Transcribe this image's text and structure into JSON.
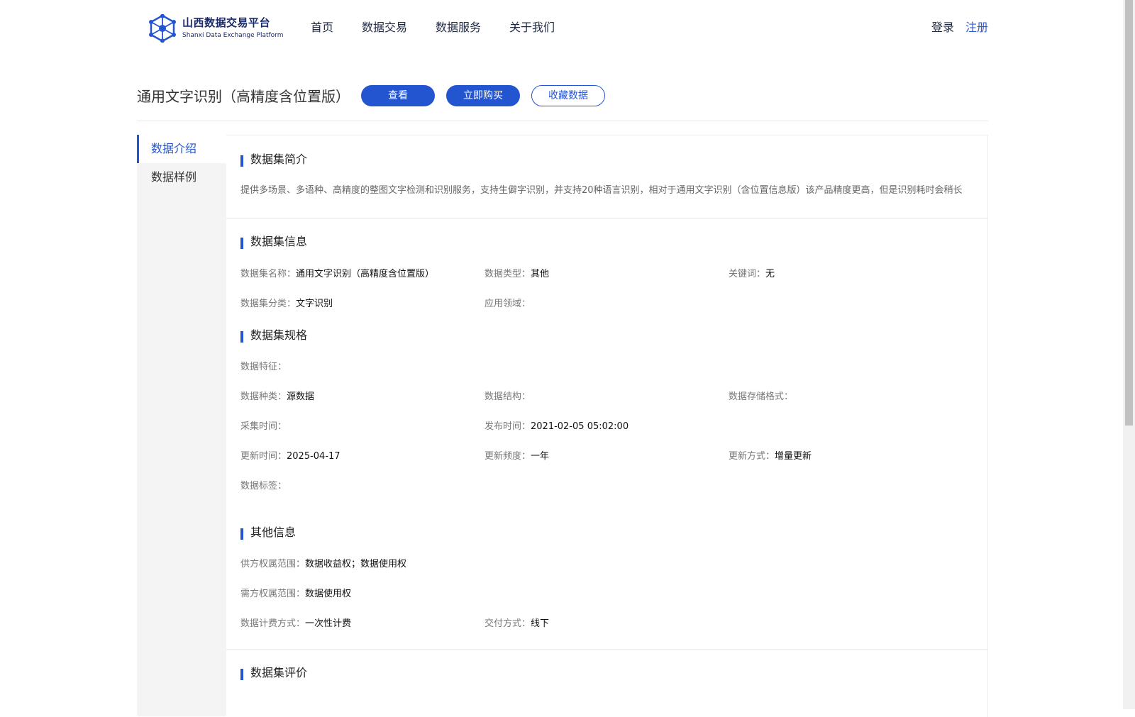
{
  "header": {
    "logo_cn": "山西数据交易平台",
    "logo_en": "Shanxi Data Exchange Platform",
    "logo_icon": "hexagon-network-icon",
    "nav": [
      "首页",
      "数据交易",
      "数据服务",
      "关于我们"
    ],
    "login": "登录",
    "register": "注册"
  },
  "title_bar": {
    "title": "通用文字识别（高精度含位置版）",
    "view_button": "查看",
    "buy_button": "立即购买",
    "favorite_button": "收藏数据"
  },
  "sidebar": {
    "items": [
      "数据介绍",
      "数据样例"
    ],
    "active": "数据介绍"
  },
  "sections": {
    "intro": {
      "title": "数据集简介",
      "text": "提供多场景、多语种、高精度的整图文字检测和识别服务，支持生僻字识别，并支持20种语言识别，相对于通用文字识别（含位置信息版）该产品精度更高，但是识别耗时会稍长"
    },
    "info": {
      "title": "数据集信息",
      "name_label": "数据集名称：",
      "name_value": "通用文字识别（高精度含位置版）",
      "type_label": "数据类型：",
      "type_value": "其他",
      "keyword_label": "关键词：",
      "keyword_value": "无",
      "category_label": "数据集分类：",
      "category_value": "文字识别",
      "domain_label": "应用领域：",
      "domain_value": ""
    },
    "spec": {
      "title": "数据集规格",
      "feature_label": "数据特征：",
      "feature_value": "",
      "kind_label": "数据种类：",
      "kind_value": "源数据",
      "structure_label": "数据结构：",
      "structure_value": "",
      "storage_label": "数据存储格式：",
      "storage_value": "",
      "collect_label": "采集时间：",
      "collect_value": "",
      "publish_label": "发布时间：",
      "publish_value": "2021-02-05 05:02:00",
      "update_label": "更新时间：",
      "update_value": "2025-04-17",
      "freq_label": "更新频度：",
      "freq_value": "一年",
      "mode_label": "更新方式：",
      "mode_value": "增量更新",
      "tag_label": "数据标签：",
      "tag_value": ""
    },
    "other": {
      "title": "其他信息",
      "supply_label": "供方权属范围：",
      "supply_value": "数据收益权；数据使用权",
      "demand_label": "需方权属范围：",
      "demand_value": "数据使用权",
      "billing_label": "数据计费方式：",
      "billing_value": "一次性计费",
      "delivery_label": "交付方式：",
      "delivery_value": "线下"
    },
    "review": {
      "title": "数据集评价"
    }
  },
  "colors": {
    "accent": "#2455d0",
    "brand_text": "#1a2a6c",
    "sidebar_bg": "#f4f4f4"
  }
}
